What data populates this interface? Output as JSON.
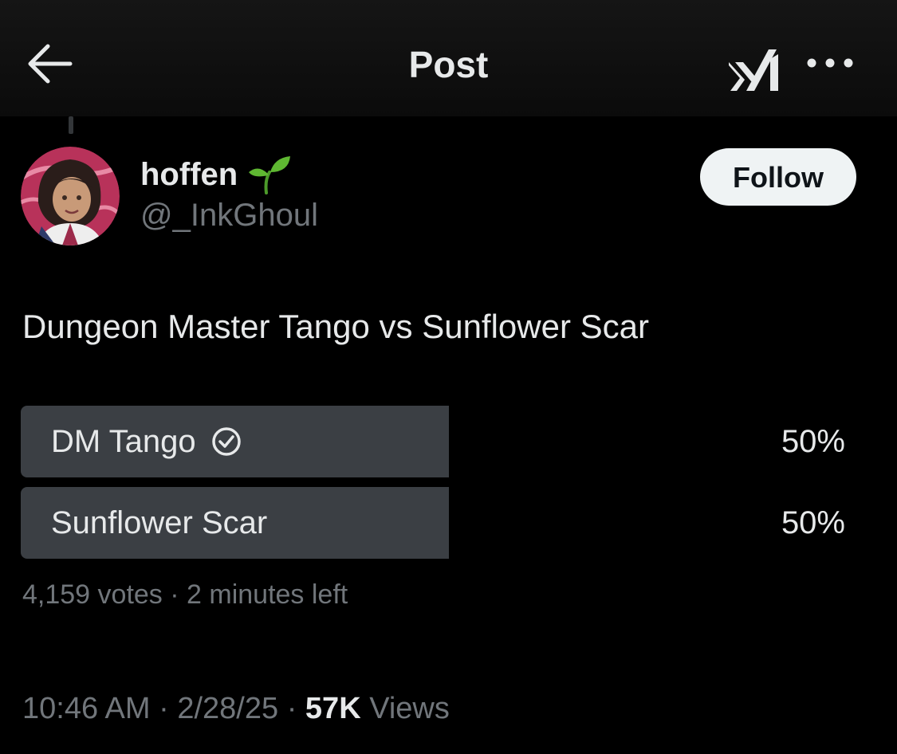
{
  "header": {
    "title": "Post",
    "back_icon": "arrow-left-icon",
    "grok_icon": "grok-logo-icon",
    "more_icon": "more-dots-icon"
  },
  "author": {
    "display_name": "hoffen",
    "name_emoji_icon": "seedling-icon",
    "handle": "@_InkGhoul",
    "avatar_icon": "avatar-illustration",
    "follow_label": "Follow"
  },
  "post": {
    "text": "Dungeon Master Tango vs Sunflower Scar"
  },
  "poll": {
    "options": [
      {
        "label": "DM Tango",
        "percent": "50%",
        "share": 0.5,
        "selected": true
      },
      {
        "label": "Sunflower Scar",
        "percent": "50%",
        "share": 0.5,
        "selected": false
      }
    ],
    "votes": "4,159 votes",
    "separator": " · ",
    "time_left": "2 minutes left"
  },
  "meta": {
    "time": "10:46 AM",
    "date": "2/28/25",
    "separator": " · ",
    "views_count": "57K",
    "views_label": " Views"
  },
  "colors": {
    "background": "#000000",
    "text_primary": "#e7e9ea",
    "text_secondary": "#71767b",
    "poll_fill": "#3b3f44",
    "follow_bg": "#eff3f4"
  }
}
